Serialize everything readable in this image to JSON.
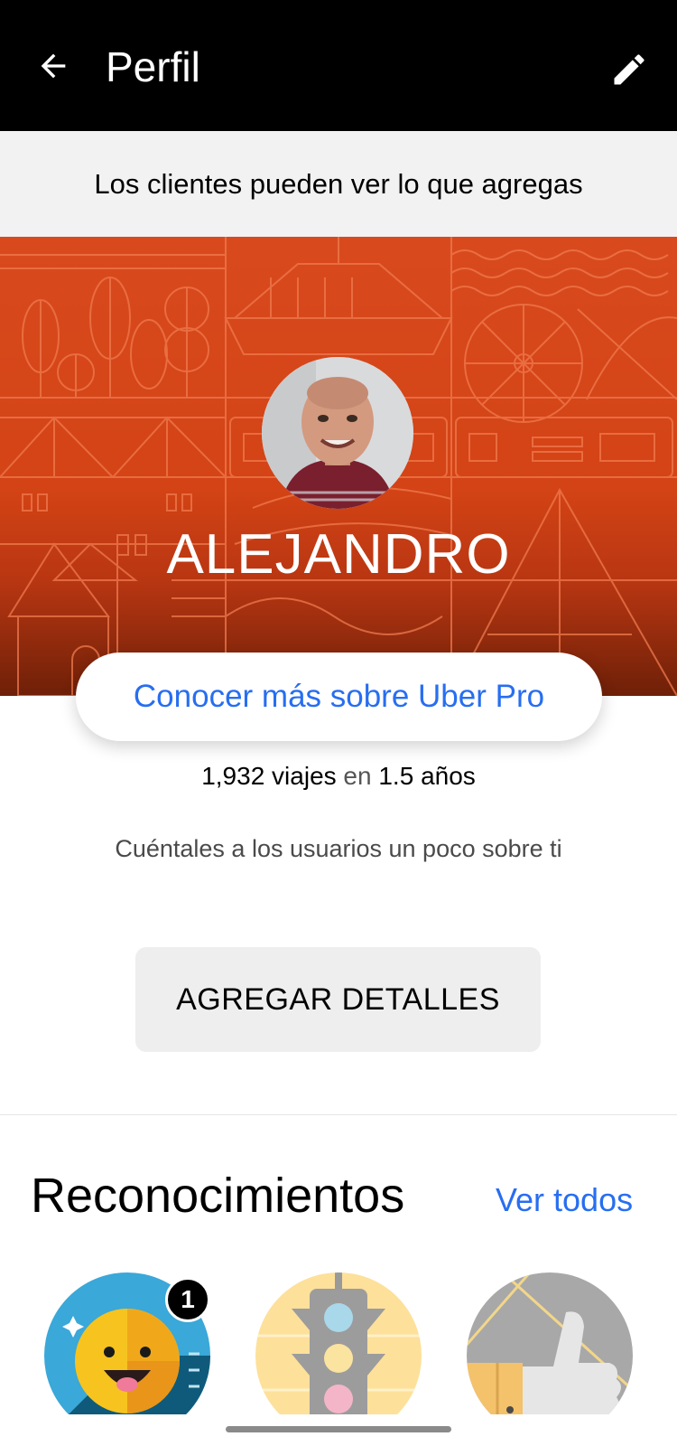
{
  "header": {
    "title": "Perfil",
    "back_icon": "arrow-left-icon",
    "edit_icon": "pencil-icon"
  },
  "notice": {
    "text": "Los clientes pueden ver lo que agregas"
  },
  "profile": {
    "name": "ALEJANDRO",
    "uber_pro_link": "Conocer más sobre Uber Pro",
    "trips": "1,932 viajes",
    "connector": "en",
    "years": "1.5 años",
    "about_prompt": "Cuéntales a los usuarios un poco sobre ti",
    "add_details_button": "AGREGAR DETALLES"
  },
  "recognitions": {
    "title": "Reconocimientos",
    "see_all": "Ver todos",
    "badges": [
      {
        "icon": "smiley-face-icon",
        "count": "1"
      },
      {
        "icon": "traffic-light-icon"
      },
      {
        "icon": "thumbs-up-icon"
      }
    ]
  },
  "colors": {
    "accent_blue": "#276ef1",
    "hero_orange": "#d84a1e",
    "header_black": "#000000"
  }
}
